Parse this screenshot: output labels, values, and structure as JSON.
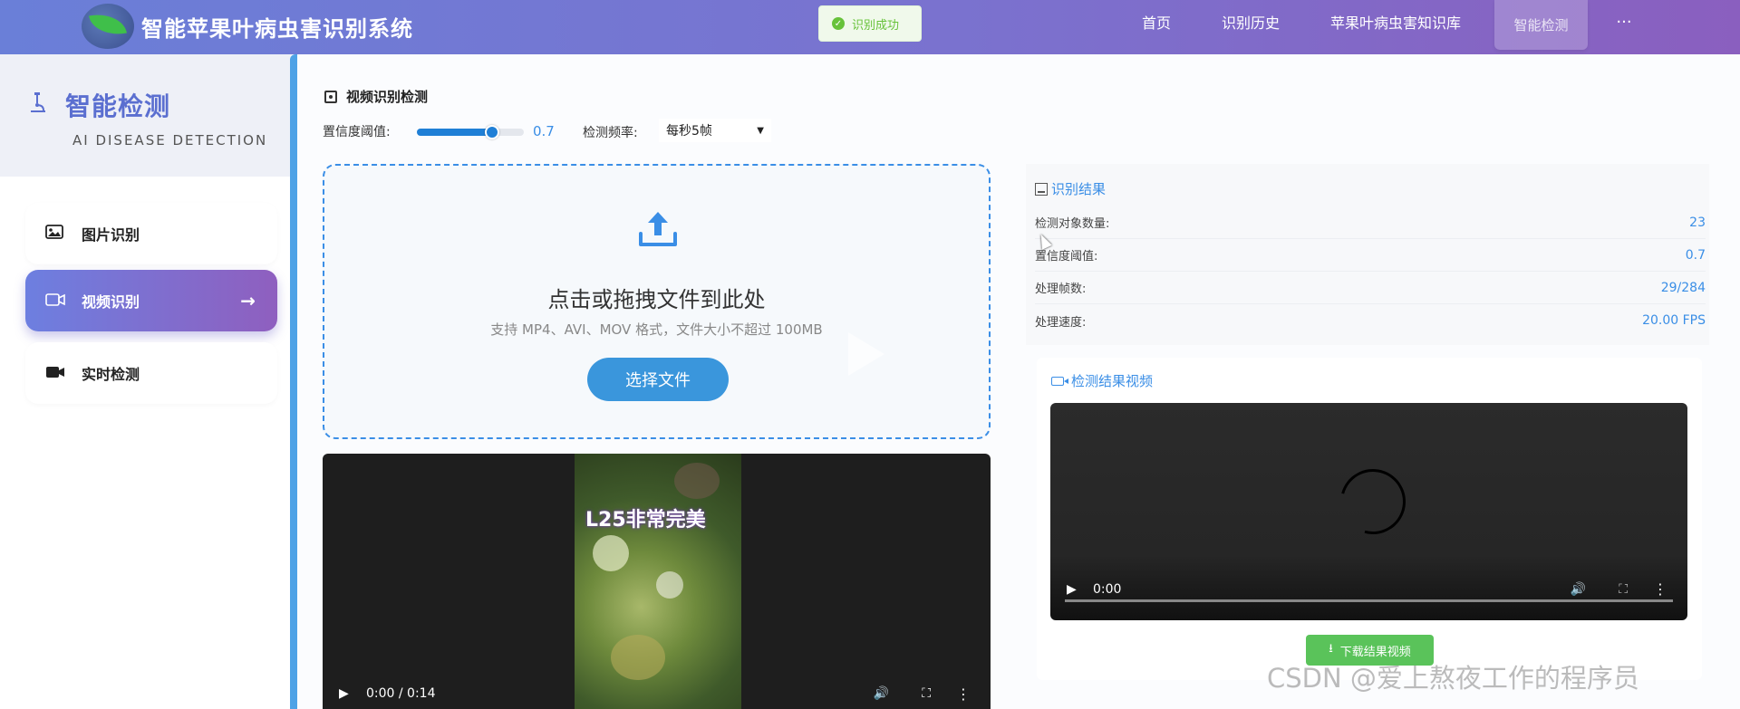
{
  "header": {
    "title": "智能苹果叶病虫害识别系统",
    "toast": "识别成功",
    "nav": {
      "home": "首页",
      "history": "识别历史",
      "knowledge": "苹果叶病虫害知识库",
      "active": "智能检测",
      "more": "···"
    }
  },
  "sidebar": {
    "title": "智能检测",
    "subtitle": "AI DISEASE DETECTION",
    "items": [
      {
        "label": "图片识别",
        "icon": "image-icon"
      },
      {
        "label": "视频识别",
        "icon": "video-icon",
        "arrow": "→"
      },
      {
        "label": "实时检测",
        "icon": "camera-icon"
      }
    ]
  },
  "main": {
    "section_title": "视频识别检测",
    "confidence_label": "置信度阈值:",
    "confidence_value": "0.7",
    "confidence_fraction": 0.7,
    "frequency_label": "检测频率:",
    "frequency_value": "每秒5帧",
    "upload": {
      "title": "点击或拖拽文件到此处",
      "hint": "支持 MP4、AVI、MOV 格式，文件大小不超过 100MB",
      "button": "选择文件"
    },
    "video": {
      "caption": "L25非常完美",
      "time": "0:00 / 0:14"
    }
  },
  "results": {
    "title": "识别结果",
    "rows": [
      {
        "label": "检测对象数量:",
        "value": "23"
      },
      {
        "label": "置信度阈值:",
        "value": "0.7"
      },
      {
        "label": "处理帧数:",
        "value": "29/284"
      },
      {
        "label": "处理速度:",
        "value": "20.00 FPS"
      }
    ],
    "video_title": "检测结果视频",
    "video_time": "0:00",
    "download": "下载结果视频"
  },
  "watermark": "CSDN @爱上熬夜工作的程序员",
  "colors": {
    "accent": "#3a8ee6",
    "header_start": "#6a7fd8",
    "header_end": "#8a5fbf",
    "success": "#67c23a"
  }
}
